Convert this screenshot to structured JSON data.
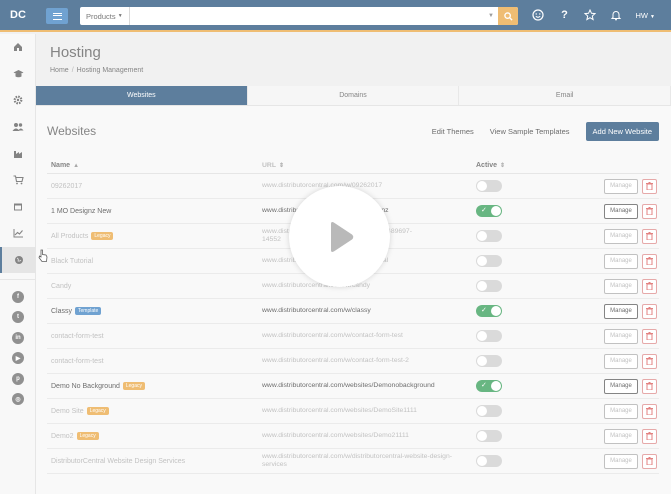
{
  "topbar": {
    "logo": "DC",
    "search_scope": "Products",
    "search_placeholder": "",
    "user_initials": "HW"
  },
  "page": {
    "title": "Hosting",
    "breadcrumb": [
      "Home",
      "Hosting Management"
    ]
  },
  "tabs": [
    {
      "label": "Websites",
      "active": true
    },
    {
      "label": "Domains",
      "active": false
    },
    {
      "label": "Email",
      "active": false
    }
  ],
  "section": {
    "title": "Websites",
    "edit_themes": "Edit Themes",
    "view_templates": "View Sample Templates",
    "add_new": "Add New Website"
  },
  "table": {
    "headers": {
      "name": "Name",
      "url": "URL",
      "active": "Active"
    },
    "manage_label": "Manage",
    "rows": [
      {
        "name": "09262017",
        "badge": null,
        "url": "www.distributorcentral.com/w/09262017",
        "url2": "",
        "active": false
      },
      {
        "name": "1 MO Designz New",
        "badge": null,
        "url": "www.distributorcentral.com/w/1modesignz",
        "url2": "",
        "active": true
      },
      {
        "name": "All Products",
        "badge": "Legacy",
        "url": "www.distributorcentral.com/websites/375-489697-",
        "url2": "14552",
        "active": false
      },
      {
        "name": "Black Tutorial",
        "badge": null,
        "url": "www.distributorcentral.com/w/blacktutorial",
        "url2": "",
        "active": false
      },
      {
        "name": "Candy",
        "badge": null,
        "url": "www.distributorcentral.com/w/candy",
        "url2": "",
        "active": false
      },
      {
        "name": "Classy",
        "badge": "Template",
        "url": "www.distributorcentral.com/w/classy",
        "url2": "",
        "active": true
      },
      {
        "name": "contact-form-test",
        "badge": null,
        "url": "www.distributorcentral.com/w/contact-form-test",
        "url2": "",
        "active": false
      },
      {
        "name": "contact-form-test",
        "badge": null,
        "url": "www.distributorcentral.com/w/contact-form-test-2",
        "url2": "",
        "active": false
      },
      {
        "name": "Demo No Background",
        "badge": "Legacy",
        "url": "www.distributorcentral.com/websites/Demonobackground",
        "url2": "",
        "active": true
      },
      {
        "name": "Demo Site",
        "badge": "Legacy",
        "url": "www.distributorcentral.com/websites/DemoSite1111",
        "url2": "",
        "active": false
      },
      {
        "name": "Demo2",
        "badge": "Legacy",
        "url": "www.distributorcentral.com/websites/Demo21111",
        "url2": "",
        "active": false
      },
      {
        "name": "DistributorCentral Website Design Services",
        "badge": null,
        "url": "www.distributorcentral.com/w/distributorcentral-website-design-",
        "url2": "services",
        "active": false
      }
    ]
  },
  "colors": {
    "brand": "#1f4d78",
    "accent": "#e9a43d",
    "active_toggle": "#2f9a52",
    "delete": "#d9534f"
  },
  "overlay": {
    "icon": "play-icon"
  }
}
